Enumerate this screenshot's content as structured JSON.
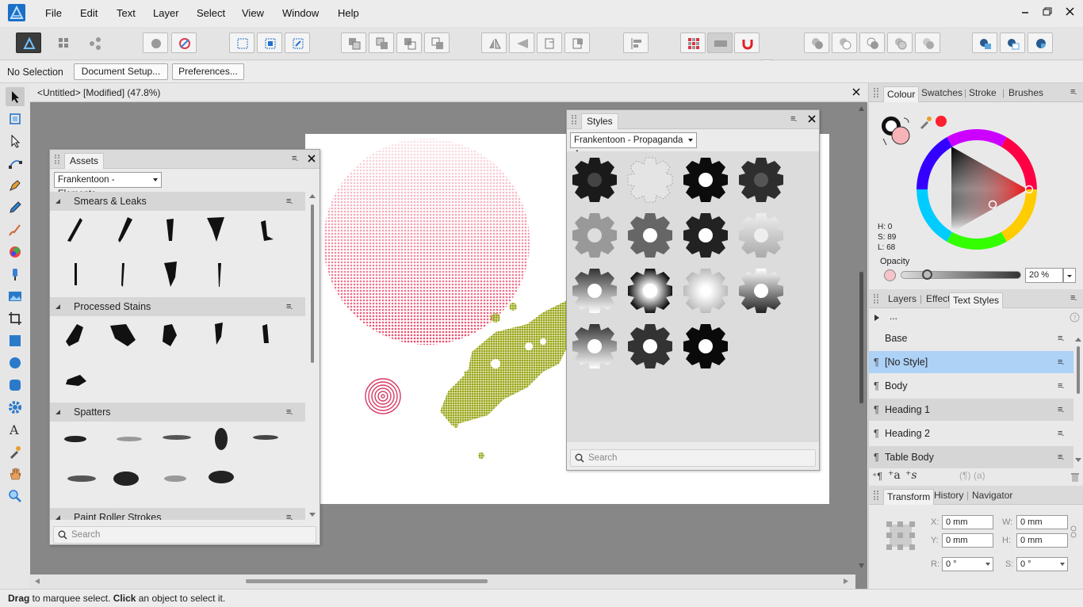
{
  "menubar": {
    "items": [
      "File",
      "Edit",
      "Text",
      "Layer",
      "Select",
      "View",
      "Window",
      "Help"
    ]
  },
  "contextbar": {
    "selection_label": "No Selection",
    "document_setup": "Document Setup...",
    "preferences": "Preferences..."
  },
  "document": {
    "tab_title": "<Untitled> [Modified] (47.8%)"
  },
  "assets_panel": {
    "tab": "Assets",
    "category_dropdown": "Frankentoon - Elements",
    "categories": [
      "Smears & Leaks",
      "Processed Stains",
      "Spatters",
      "Paint Roller Strokes"
    ],
    "search_placeholder": "Search"
  },
  "styles_panel": {
    "tab": "Styles",
    "category_dropdown": "Frankentoon - Propaganda A",
    "search_placeholder": "Search"
  },
  "colour_panel": {
    "tabs": [
      "Colour",
      "Swatches",
      "Stroke",
      "Brushes"
    ],
    "h": "H: 0",
    "s": "S: 89",
    "l": "L: 68",
    "opacity_label": "Opacity",
    "opacity_value": "20 %",
    "accent": "#ff1f2e"
  },
  "text_styles_panel": {
    "tabs": [
      "Layers",
      "Effects",
      "Text Styles"
    ],
    "breadcrumb": "...",
    "styles": [
      "Base",
      "[No Style]",
      "Body",
      "Heading 1",
      "Heading 2",
      "Table Body"
    ],
    "selected_index": 1
  },
  "transform_panel": {
    "tabs": [
      "Transform",
      "History",
      "Navigator"
    ],
    "x_label": "X:",
    "x_value": "0 mm",
    "y_label": "Y:",
    "y_value": "0 mm",
    "w_label": "W:",
    "w_value": "0 mm",
    "h_label": "H:",
    "h_value": "0 mm",
    "r_label": "R:",
    "r_value": "0 °",
    "s_label": "S:",
    "s_value": "0 °"
  },
  "statusbar": {
    "bold1": "Drag",
    "text1": " to marquee select. ",
    "bold2": "Click",
    "text2": " an object to select it."
  }
}
